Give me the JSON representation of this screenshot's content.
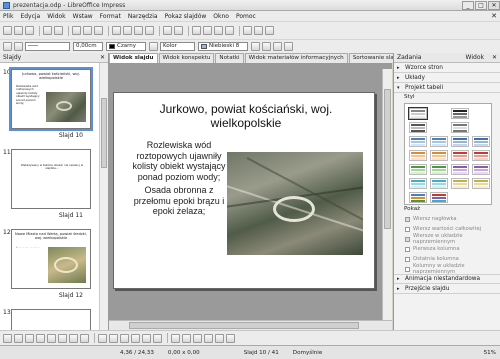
{
  "window": {
    "title": "prezentacja.odp - LibreOffice Impress",
    "buttons": [
      "_",
      "□",
      "✕"
    ]
  },
  "menu": [
    "Plik",
    "Edycja",
    "Widok",
    "Wstaw",
    "Format",
    "Narzędzia",
    "Pokaz slajdów",
    "Okno",
    "Pomoc"
  ],
  "toolbar2": {
    "line_width": "0,00cm",
    "line_color": "Czarny",
    "area_style": "Kolor",
    "area_color": "Niebieski 8"
  },
  "colors": {
    "accent": "#5b8fd8",
    "line_swatch": "#000000",
    "fill_swatch": "#9cb8e0"
  },
  "slides_panel": {
    "title": "Slajdy",
    "items": [
      {
        "num": "10",
        "label": "Slajd 10",
        "title": "Jurkowo, powiat kościański, woj. wielkopolskie",
        "selected": true
      },
      {
        "num": "11",
        "label": "Slajd 11",
        "title": "",
        "text": "Wskazywany w tekście obszar nie opisany w slajdzie..."
      },
      {
        "num": "12",
        "label": "Slajd 12",
        "title": "Nowe Miasto nad Wartą, powiat średzki, woj. wielkopolskie"
      },
      {
        "num": "13",
        "label": "",
        "title": ""
      }
    ]
  },
  "tabs": [
    "Widok slajdu",
    "Widok konspektu",
    "Notatki",
    "Widok materiałów informacyjnych",
    "Sortowanie slajdów"
  ],
  "slide": {
    "title": "Jurkowo, powiat kościański, woj. wielkopolskie",
    "bullets": [
      "Rozlewiska wód roztopowych ujawniły kolisty obiekt wystający ponad poziom wody;",
      "Osada obronna z przełomu epoki brązu i epoki żelaza;"
    ]
  },
  "tasks_panel": {
    "title": "Zadania",
    "view": "Widok",
    "sections": [
      "Wzorce stron",
      "Układy",
      "Projekt tabeli"
    ],
    "style_label": "Styl",
    "show_label": "Pokaż",
    "options": [
      {
        "label": "Wiersz nagłówka",
        "checked": true
      },
      {
        "label": "Wiersz wartości całkowitej",
        "checked": false
      },
      {
        "label": "Wiersze w układzie naprzemiennym",
        "checked": true
      },
      {
        "label": "Pierwsza kolumna",
        "checked": false
      },
      {
        "label": "Ostatnia kolumna",
        "checked": false
      },
      {
        "label": "Kolumny w układzie naprzemiennym",
        "checked": false
      }
    ],
    "bottom_sections": [
      "Animacja niestandardowa",
      "Przejście slajdu"
    ]
  },
  "status": {
    "position": "4,36 / 24,33",
    "size": "0,00 x 0,00",
    "slide": "Slajd 10 / 41",
    "layout": "Domyślnie",
    "zoom": "51%"
  }
}
